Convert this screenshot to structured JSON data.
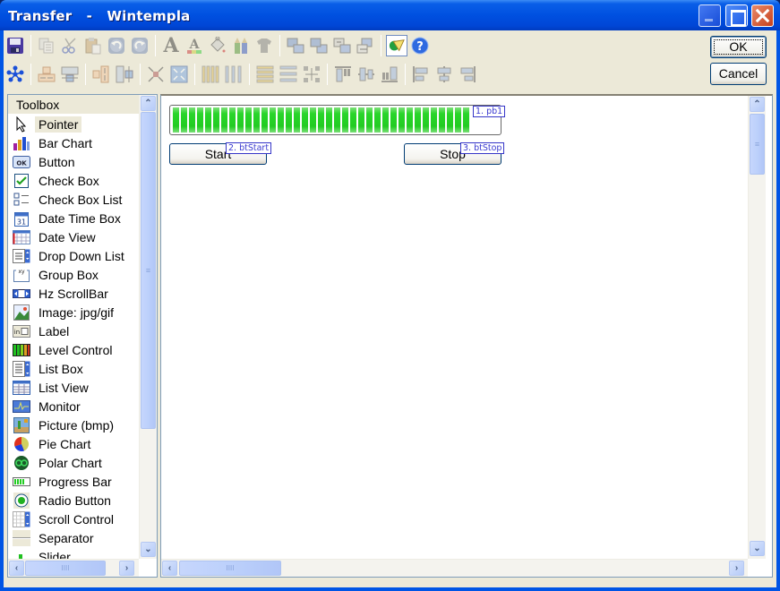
{
  "window": {
    "title": "Transfer   -   Wintempla",
    "controls": [
      "minimize",
      "maximize",
      "close"
    ]
  },
  "toolbar": {
    "row1": [
      {
        "name": "save-icon",
        "enabled": true
      },
      {
        "name": "copy-icon",
        "enabled": false
      },
      {
        "name": "cut-icon",
        "enabled": false
      },
      {
        "name": "paste-icon",
        "enabled": false
      },
      {
        "name": "undo-icon",
        "enabled": false
      },
      {
        "name": "redo-icon",
        "enabled": false
      },
      {
        "name": "font-icon",
        "enabled": false
      },
      {
        "name": "font-color-icon",
        "enabled": false
      },
      {
        "name": "fill-color-icon",
        "enabled": false
      },
      {
        "name": "pencils-icon",
        "enabled": false
      },
      {
        "name": "shirt-icon",
        "enabled": false
      },
      {
        "name": "bring-to-front-icon",
        "enabled": false
      },
      {
        "name": "send-to-back-icon",
        "enabled": false
      },
      {
        "name": "move-forward-icon",
        "enabled": false
      },
      {
        "name": "move-backward-icon",
        "enabled": false
      },
      {
        "name": "tab-order-icon",
        "enabled": true
      },
      {
        "name": "help-icon",
        "enabled": true
      }
    ],
    "row2": [
      {
        "name": "select-all-icon",
        "enabled": true
      },
      {
        "name": "same-width-icon",
        "enabled": false
      },
      {
        "name": "resize-width-icon",
        "enabled": false
      },
      {
        "name": "same-height-icon",
        "enabled": false
      },
      {
        "name": "resize-height-icon",
        "enabled": false
      },
      {
        "name": "shrink-icon",
        "enabled": false
      },
      {
        "name": "expand-icon",
        "enabled": false
      },
      {
        "name": "space-horizontal-icon",
        "enabled": false
      },
      {
        "name": "space-horizontal-equal-icon",
        "enabled": false
      },
      {
        "name": "space-vertical-icon",
        "enabled": false
      },
      {
        "name": "space-vertical-equal-icon",
        "enabled": false
      },
      {
        "name": "center-both-icon",
        "enabled": false
      },
      {
        "name": "align-top-icon",
        "enabled": false
      },
      {
        "name": "align-middle-icon",
        "enabled": false
      },
      {
        "name": "align-bottom-icon",
        "enabled": false
      },
      {
        "name": "align-left-icon",
        "enabled": false
      },
      {
        "name": "align-center-icon",
        "enabled": false
      },
      {
        "name": "align-right-icon",
        "enabled": false
      }
    ]
  },
  "dialog_buttons": {
    "ok": "OK",
    "cancel": "Cancel"
  },
  "toolbox": {
    "header": "Toolbox",
    "items": [
      {
        "label": "Pointer",
        "icon": "pointer-icon",
        "selected": true
      },
      {
        "label": "Bar Chart",
        "icon": "bar-chart-icon"
      },
      {
        "label": "Button",
        "icon": "button-icon"
      },
      {
        "label": "Check Box",
        "icon": "check-box-icon"
      },
      {
        "label": "Check Box List",
        "icon": "check-box-list-icon"
      },
      {
        "label": "Date Time Box",
        "icon": "calendar-icon"
      },
      {
        "label": "Date View",
        "icon": "date-view-icon"
      },
      {
        "label": "Drop Down List",
        "icon": "drop-down-list-icon"
      },
      {
        "label": "Group Box",
        "icon": "group-box-icon"
      },
      {
        "label": "Hz ScrollBar",
        "icon": "hz-scrollbar-icon"
      },
      {
        "label": "Image: jpg/gif",
        "icon": "image-icon"
      },
      {
        "label": "Label",
        "icon": "label-icon"
      },
      {
        "label": "Level Control",
        "icon": "level-control-icon"
      },
      {
        "label": "List Box",
        "icon": "list-box-icon"
      },
      {
        "label": "List View",
        "icon": "list-view-icon"
      },
      {
        "label": "Monitor",
        "icon": "monitor-icon"
      },
      {
        "label": "Picture (bmp)",
        "icon": "picture-icon"
      },
      {
        "label": "Pie Chart",
        "icon": "pie-chart-icon"
      },
      {
        "label": "Polar Chart",
        "icon": "polar-chart-icon"
      },
      {
        "label": "Progress Bar",
        "icon": "progress-bar-icon"
      },
      {
        "label": "Radio Button",
        "icon": "radio-button-icon"
      },
      {
        "label": "Scroll Control",
        "icon": "scroll-control-icon"
      },
      {
        "label": "Separator",
        "icon": "separator-icon"
      },
      {
        "label": "Slider",
        "icon": "slider-icon"
      }
    ]
  },
  "designer": {
    "controls": {
      "progress": {
        "tag": "1. pb1",
        "value_percent": 91,
        "color": "#22cc22"
      },
      "start": {
        "label": "Start",
        "tag": "2. btStart"
      },
      "stop": {
        "label": "Stop",
        "tag": "3. btStop"
      }
    }
  },
  "scroll_glyphs": {
    "up": "⌃",
    "down": "⌄",
    "left": "‹",
    "right": "›",
    "grip_v": "≡",
    "grip_h": "IIII"
  }
}
